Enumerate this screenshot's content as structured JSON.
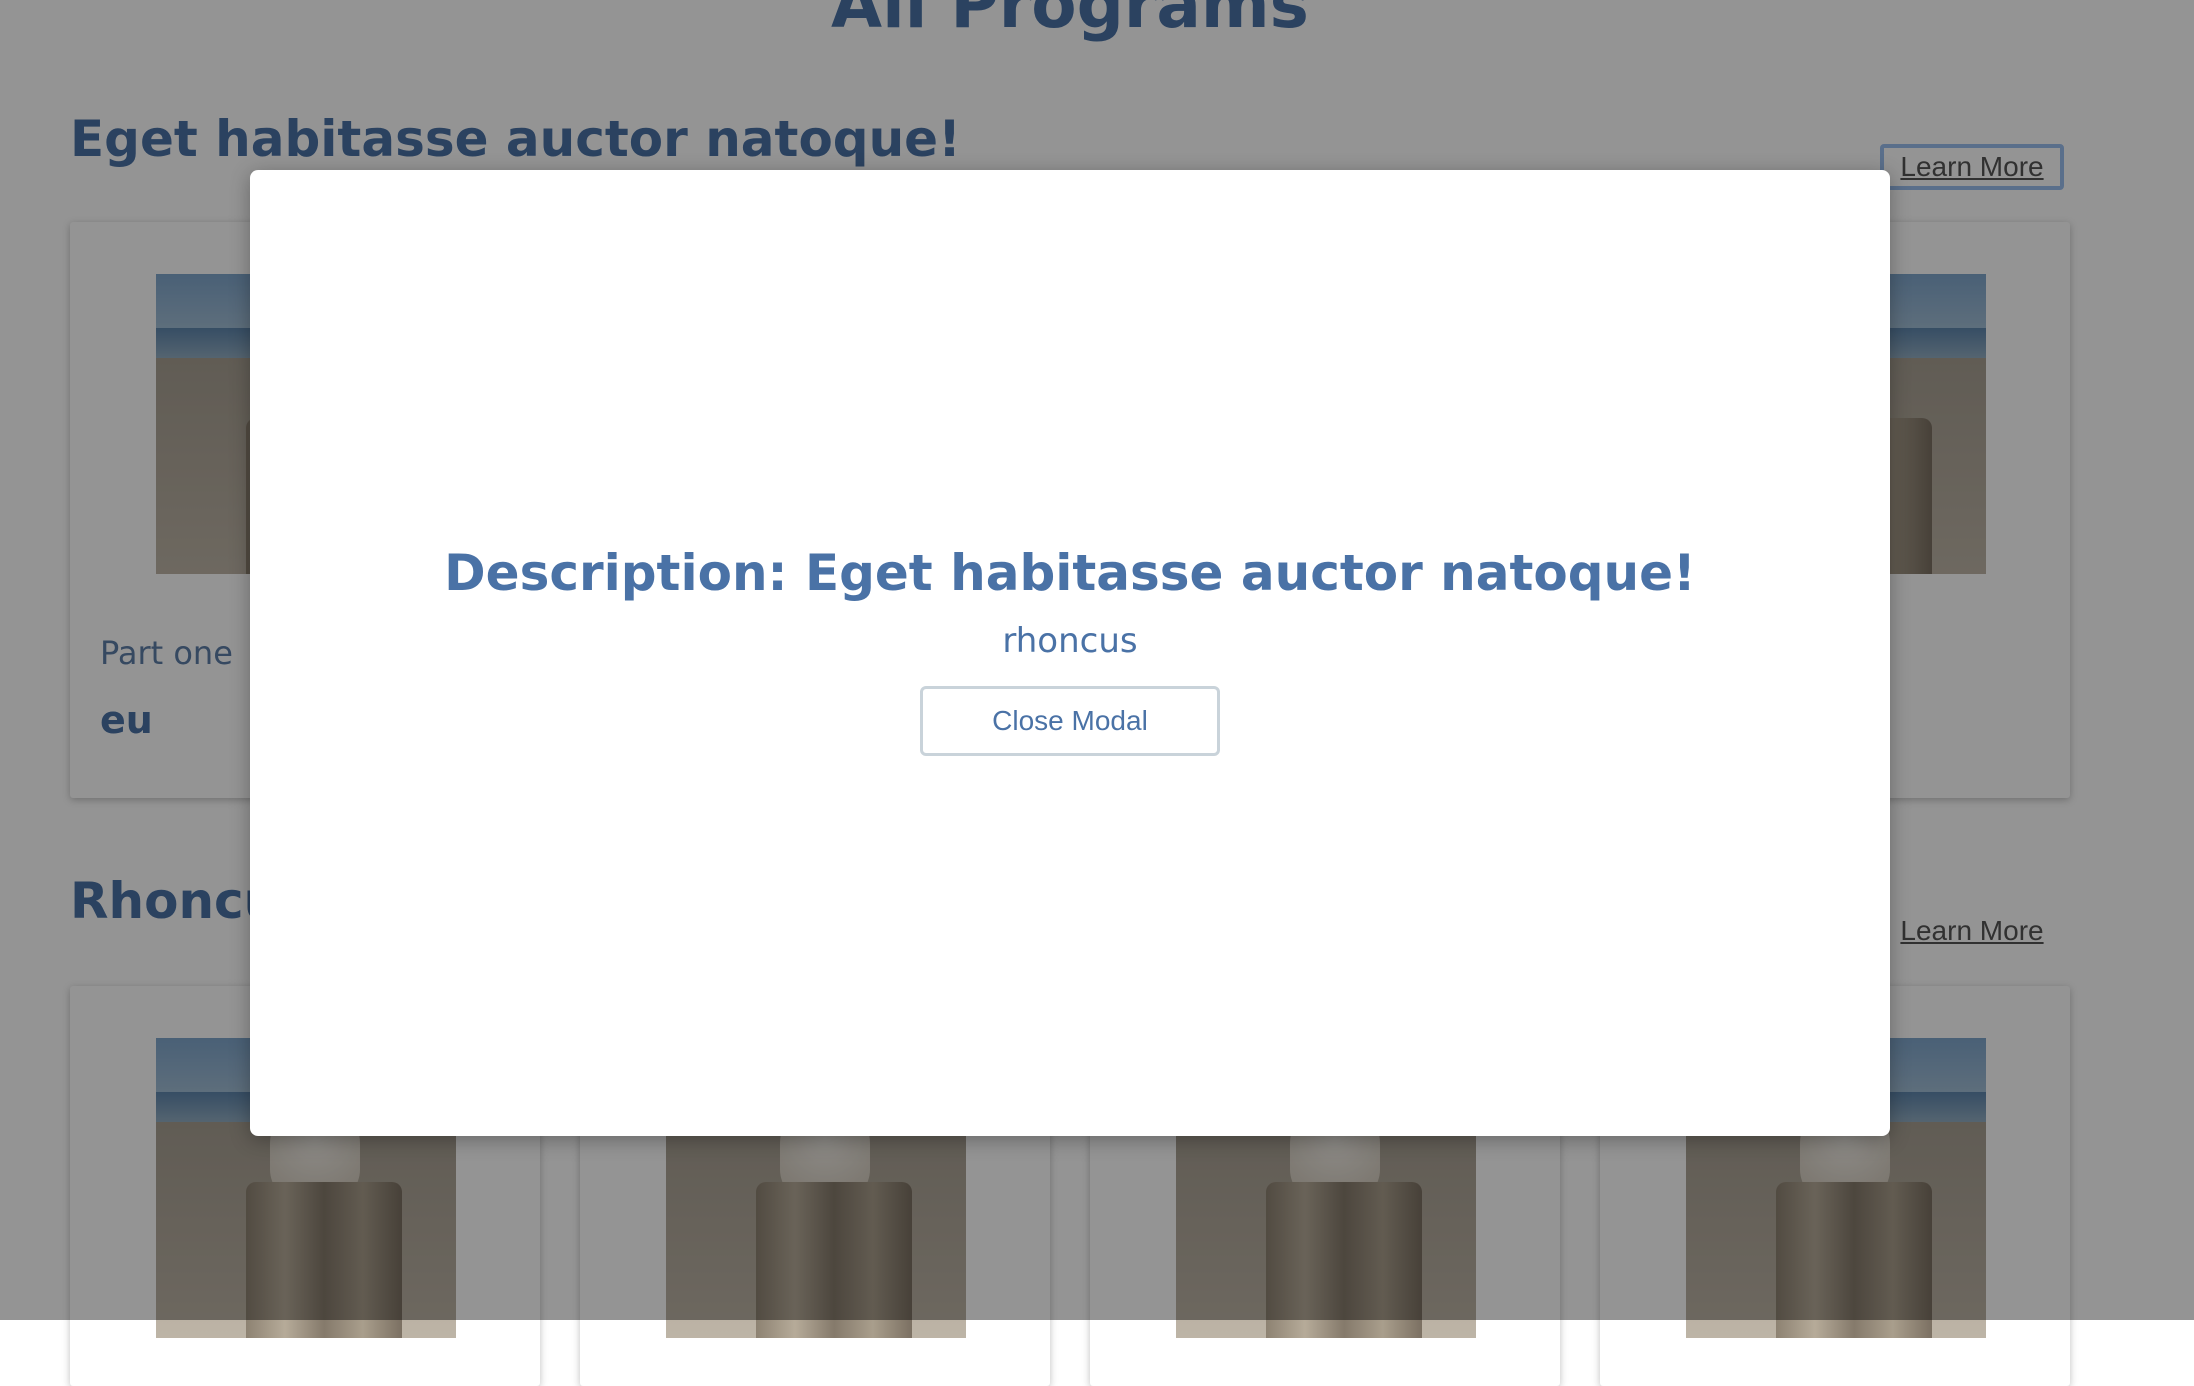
{
  "page": {
    "title": "All Programs"
  },
  "sections": [
    {
      "title": "Eget habitasse auctor natoque!",
      "learn_more": "Learn More",
      "cards": [
        {
          "label": "Part one",
          "value": "eu"
        },
        {
          "label": "",
          "value": ""
        },
        {
          "label": "",
          "value": ""
        },
        {
          "label": "",
          "value": ""
        }
      ]
    },
    {
      "title": "Rhoncu",
      "learn_more": "Learn More"
    }
  ],
  "modal": {
    "title": "Description: Eget habitasse auctor natoque!",
    "text": "rhoncus",
    "close_label": "Close Modal"
  },
  "colors": {
    "accent": "#4a72a6",
    "overlay": "rgba(0,0,0,0.42)"
  }
}
